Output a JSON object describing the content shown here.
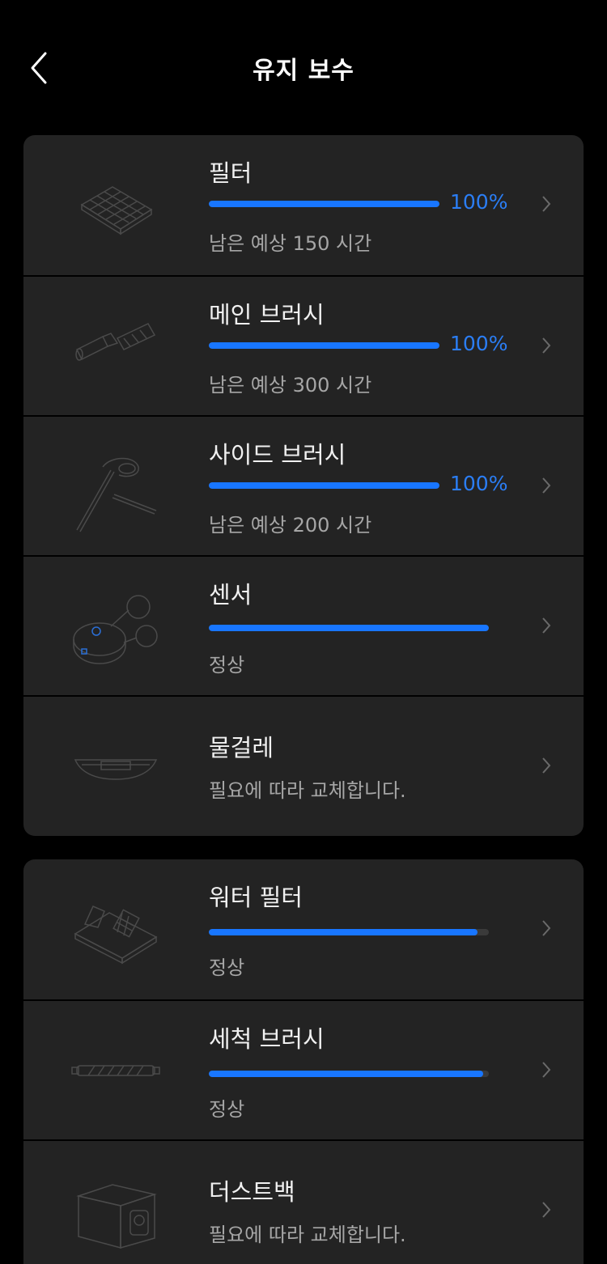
{
  "header": {
    "title": "유지 보수"
  },
  "groups": [
    {
      "items": [
        {
          "name": "필터",
          "progress": 1.0,
          "percent_text": "100%",
          "subtitle": "남은 예상 150 시간",
          "icon": "filter-icon"
        },
        {
          "name": "메인 브러시",
          "progress": 1.0,
          "percent_text": "100%",
          "subtitle": "남은 예상 300 시간",
          "icon": "main-brush-icon"
        },
        {
          "name": "사이드 브러시",
          "progress": 1.0,
          "percent_text": "100%",
          "subtitle": "남은 예상 200 시간",
          "icon": "side-brush-icon"
        },
        {
          "name": "센서",
          "progress": 1.0,
          "subtitle": "정상",
          "icon": "sensor-robot-icon"
        },
        {
          "name": "물걸레",
          "subtitle": "필요에 따라 교체합니다.",
          "icon": "mop-icon"
        }
      ]
    },
    {
      "items": [
        {
          "name": "워터 필터",
          "progress": 0.96,
          "subtitle": "정상",
          "icon": "water-filter-icon"
        },
        {
          "name": "세척 브러시",
          "progress": 0.98,
          "subtitle": "정상",
          "icon": "cleaning-brush-icon"
        },
        {
          "name": "더스트백",
          "subtitle": "필요에 따라 교체합니다.",
          "icon": "dust-bag-icon"
        }
      ]
    }
  ],
  "colors": {
    "accent": "#1876ff",
    "percent_text": "#2b7ef5",
    "card": "#232323",
    "background": "#000000"
  }
}
